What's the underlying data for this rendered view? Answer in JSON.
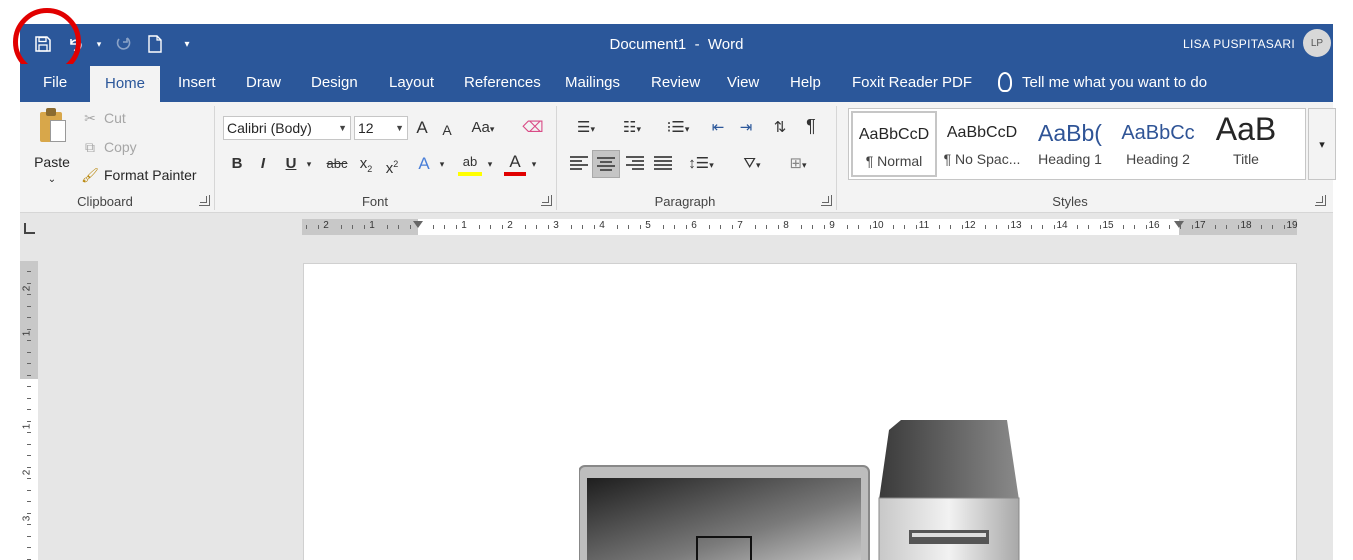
{
  "window": {
    "document_name": "Document1",
    "separator": "-",
    "app_name": "Word",
    "user_name": "LISA PUSPITASARI",
    "user_initials": "LP"
  },
  "quick_access": {
    "save_icon": "save-icon",
    "undo_icon": "undo-icon",
    "redo_icon": "redo-icon",
    "new_icon": "new-document-icon",
    "customize_icon": "customize-qat-icon"
  },
  "tabs": [
    {
      "label": "File"
    },
    {
      "label": "Home"
    },
    {
      "label": "Insert"
    },
    {
      "label": "Draw"
    },
    {
      "label": "Design"
    },
    {
      "label": "Layout"
    },
    {
      "label": "References"
    },
    {
      "label": "Mailings"
    },
    {
      "label": "Review"
    },
    {
      "label": "View"
    },
    {
      "label": "Help"
    },
    {
      "label": "Foxit Reader PDF"
    }
  ],
  "tell_me": "Tell me what you want to do",
  "clipboard": {
    "paste": "Paste",
    "cut": "Cut",
    "copy": "Copy",
    "format_painter": "Format Painter",
    "label": "Clipboard"
  },
  "font": {
    "name": "Calibri (Body)",
    "size": "12",
    "label": "Font",
    "grow": "A",
    "shrink": "A",
    "change_case": "Aa",
    "bold": "B",
    "italic": "I",
    "underline": "U",
    "strike": "abc",
    "subscript": "x",
    "superscript": "x",
    "sub_mark": "2",
    "sup_mark": "2",
    "text_effects": "A",
    "highlight": "ab",
    "font_color": "A",
    "highlight_color": "#ffff00",
    "font_color_value": "#e00000"
  },
  "paragraph": {
    "label": "Paragraph",
    "pilcrow": "¶"
  },
  "styles": {
    "label": "Styles",
    "items": [
      {
        "preview": "AaBbCcD",
        "name": "¶ Normal"
      },
      {
        "preview": "AaBbCcD",
        "name": "¶ No Spac..."
      },
      {
        "preview": "AaBb(",
        "name": "Heading 1"
      },
      {
        "preview": "AaBbCc",
        "name": "Heading 2"
      },
      {
        "preview": "AaB",
        "name": "Title"
      }
    ]
  },
  "ruler": {
    "h_left_numbers": [
      "2",
      "1"
    ],
    "h_right_numbers": [
      "1",
      "2",
      "3",
      "4",
      "5",
      "6",
      "7",
      "8",
      "9",
      "10",
      "11",
      "12",
      "13",
      "14",
      "15",
      "16",
      "17",
      "18",
      "19"
    ],
    "v_numbers": [
      "2",
      "1",
      "1",
      "2",
      "3"
    ]
  },
  "colors": {
    "accent": "#2b579a",
    "ribbon_bg": "#f3f3f3",
    "canvas_bg": "#e6e6e6",
    "highlight_ring": "#e10000"
  }
}
